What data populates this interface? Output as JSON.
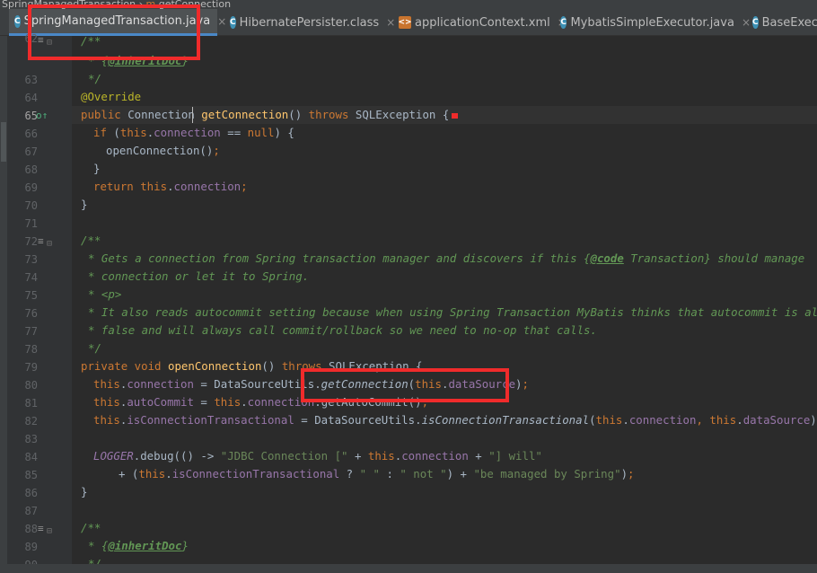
{
  "breadcrumb": {
    "file": "SpringManagedTransaction",
    "separator": "›",
    "method_icon": "m",
    "method": "getConnection"
  },
  "tabs": [
    {
      "label": "SpringManagedTransaction.java",
      "icon": "class-icon",
      "icon_letter": "C",
      "close": "×",
      "active": true
    },
    {
      "label": "HibernatePersister.class",
      "icon": "class-icon",
      "icon_letter": "C",
      "close": "×",
      "active": false
    },
    {
      "label": "applicationContext.xml",
      "icon": "xml-icon",
      "icon_letter": "<>",
      "close": "×",
      "active": false
    },
    {
      "label": "MybatisSimpleExecutor.java",
      "icon": "class-icon",
      "icon_letter": "C",
      "close": "×",
      "active": false
    },
    {
      "label": "BaseExecu",
      "icon": "class-icon",
      "icon_letter": "C",
      "close": "",
      "active": false
    }
  ],
  "line_numbers": [
    "62",
    "63",
    "64",
    "65",
    "66",
    "67",
    "68",
    "69",
    "70",
    "71",
    "72",
    "73",
    "74",
    "75",
    "76",
    "77",
    "78",
    "79",
    "80",
    "81",
    "82",
    "83",
    "84",
    "85",
    "86",
    "87",
    "88",
    "89",
    "90"
  ],
  "current_line": "65",
  "code": {
    "l62": {
      "c": "/**"
    },
    "l62b": {
      "t1": "* {",
      "tag": "@inheritDoc",
      "t2": "}"
    },
    "l63": {
      "c": "*/"
    },
    "l64": {
      "ann": "@Override"
    },
    "l65": {
      "kw": "public ",
      "t1": "Connection ",
      "fn": "getConnection",
      "t2": "() ",
      "kw2": "throws ",
      "t3": "SQLException {"
    },
    "l66": {
      "kw": "if ",
      "t1": "(",
      "kw2": "this",
      "t2": ".",
      "f": "connection",
      "t3": " == ",
      "kw3": "null",
      "t4": ") {"
    },
    "l67": {
      "t1": "openConnection()",
      "kw": ";"
    },
    "l68": {
      "t1": "}"
    },
    "l69": {
      "kw": "return ",
      "kw2": "this",
      "t1": ".",
      "f": "connection",
      "kw3": ";"
    },
    "l70": {
      "t1": "}"
    },
    "l72": {
      "c": "/**"
    },
    "l73": {
      "c1": "* Gets a connection from Spring transaction manager and discovers if this {",
      "tag": "@code",
      "c2": " Transaction} should manage"
    },
    "l74": {
      "c": "* connection or let it to Spring."
    },
    "l75": {
      "c": "* <p>"
    },
    "l76": {
      "c": "* It also reads autocommit setting because when using Spring Transaction MyBatis thinks that autocommit is always"
    },
    "l77": {
      "c": "* false and will always call commit/rollback so we need to no-op that calls."
    },
    "l78": {
      "c": "*/"
    },
    "l79": {
      "kw": "private void ",
      "fn": "openConnection",
      "t1": "() ",
      "kw2": "throws ",
      "t2": "SQLException {"
    },
    "l80": {
      "kw": "this",
      "t1": ".",
      "f": "connection",
      "t2": " = DataSourceUtils.",
      "it": "getConnection",
      "t3": "(",
      "kw2": "this",
      "t4": ".",
      "f2": "dataSource",
      "t5": ")",
      "kw3": ";"
    },
    "l81": {
      "kw": "this",
      "t1": ".",
      "f": "autoCommit",
      "t2": " = ",
      "kw2": "this",
      "t3": ".",
      "f2": "connection",
      "t4": ".getAutoCommit()",
      "kw3": ";"
    },
    "l82": {
      "kw": "this",
      "t1": ".",
      "f": "isConnectionTransactional",
      "t2": " = DataSourceUtils.",
      "it": "isConnectionTransactional",
      "t3": "(",
      "kw2": "this",
      "t4": ".",
      "f2": "connection",
      "kw3": ", ",
      "kw4": "this",
      "t5": ".",
      "f3": "dataSource",
      "t6": ")",
      "kw5": ";"
    },
    "l84": {
      "sf": "LOGGER",
      "t1": ".debug(() -> ",
      "s1": "\"JDBC Connection [\"",
      "t2": " + ",
      "kw": "this",
      "t3": ".",
      "f": "connection",
      "t4": " + ",
      "s2": "\"] will\""
    },
    "l85": {
      "t1": "+ (",
      "kw": "this",
      "t2": ".",
      "f": "isConnectionTransactional",
      "t3": " ? ",
      "s1": "\" \"",
      "t4": " : ",
      "s2": "\" not \"",
      "t5": ") + ",
      "s3": "\"be managed by Spring\"",
      "t6": ")",
      "kw2": ";"
    },
    "l86": {
      "t1": "}"
    },
    "l88": {
      "c": "/**"
    },
    "l89": {
      "t1": "* {",
      "tag": "@inheritDoc",
      "t2": "}"
    },
    "l90": {
      "c": "*/"
    }
  },
  "gutter_icons": {
    "fold": "⊟",
    "override": "o↑",
    "doc": "≡"
  },
  "colors": {
    "highlight": "#F02B2B",
    "keyword": "#CC7832",
    "method": "#FFC66D",
    "field": "#9876AA",
    "comment": "#629755",
    "string": "#6A8759",
    "annotation": "#BBB529"
  }
}
